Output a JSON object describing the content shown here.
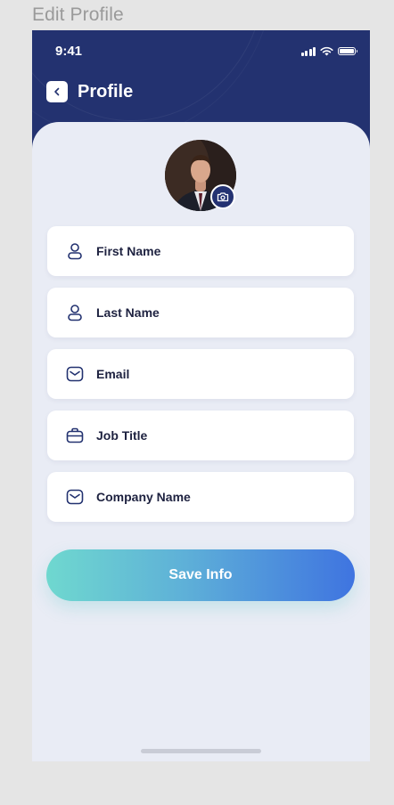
{
  "frame": {
    "label": "Edit Profile"
  },
  "status_bar": {
    "time": "9:41"
  },
  "header": {
    "title": "Profile"
  },
  "form": {
    "fields": [
      {
        "label": "First Name",
        "icon": "user-icon"
      },
      {
        "label": "Last Name",
        "icon": "user-icon"
      },
      {
        "label": "Email",
        "icon": "mail-icon"
      },
      {
        "label": "Job Title",
        "icon": "briefcase-icon"
      },
      {
        "label": "Company Name",
        "icon": "mail-icon"
      }
    ]
  },
  "actions": {
    "save_label": "Save Info"
  },
  "colors": {
    "header_bg": "#233270",
    "sheet_bg": "#e9ecf5",
    "gradient_start": "#6fd8cf",
    "gradient_end": "#3f74e0",
    "icon_color": "#233270"
  }
}
